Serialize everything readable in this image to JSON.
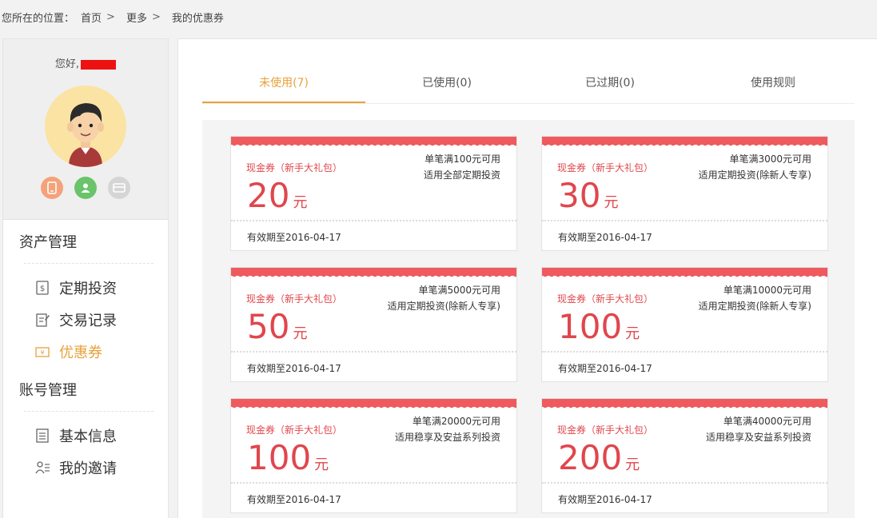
{
  "breadcrumb": {
    "prefix": "您所在的位置：",
    "items": [
      "首页",
      "更多",
      "我的优惠券"
    ],
    "separator": ">"
  },
  "sidebar": {
    "greeting": "您好,",
    "sections": [
      {
        "title": "资产管理",
        "items": [
          {
            "label": "定期投资",
            "icon": "invest-icon"
          },
          {
            "label": "交易记录",
            "icon": "edit-icon"
          },
          {
            "label": "优惠券",
            "icon": "coupon-icon",
            "active": true
          }
        ]
      },
      {
        "title": "账号管理",
        "items": [
          {
            "label": "基本信息",
            "icon": "document-icon"
          },
          {
            "label": "我的邀请",
            "icon": "invite-icon"
          }
        ]
      }
    ]
  },
  "tabs": [
    "未使用(7)",
    "已使用(0)",
    "已过期(0)",
    "使用规则"
  ],
  "coupons": [
    {
      "type": "现金券（新手大礼包）",
      "amount": "20",
      "unit": "元",
      "cond1": "单笔满100元可用",
      "cond2": "适用全部定期投资",
      "expiry": "有效期至2016-04-17"
    },
    {
      "type": "现金券（新手大礼包）",
      "amount": "30",
      "unit": "元",
      "cond1": "单笔满3000元可用",
      "cond2": "适用定期投资(除新人专享)",
      "expiry": "有效期至2016-04-17"
    },
    {
      "type": "现金券（新手大礼包）",
      "amount": "50",
      "unit": "元",
      "cond1": "单笔满5000元可用",
      "cond2": "适用定期投资(除新人专享)",
      "expiry": "有效期至2016-04-17"
    },
    {
      "type": "现金券（新手大礼包）",
      "amount": "100",
      "unit": "元",
      "cond1": "单笔满10000元可用",
      "cond2": "适用定期投资(除新人专享)",
      "expiry": "有效期至2016-04-17"
    },
    {
      "type": "现金券（新手大礼包）",
      "amount": "100",
      "unit": "元",
      "cond1": "单笔满20000元可用",
      "cond2": "适用稳享及安益系列投资",
      "expiry": "有效期至2016-04-17"
    },
    {
      "type": "现金券（新手大礼包）",
      "amount": "200",
      "unit": "元",
      "cond1": "单笔满40000元可用",
      "cond2": "适用稳享及安益系列投资",
      "expiry": "有效期至2016-04-17"
    }
  ],
  "colors": {
    "accent": "#e8a23a",
    "coupon_red": "#e0464c",
    "band_red": "#ef5a5f"
  }
}
